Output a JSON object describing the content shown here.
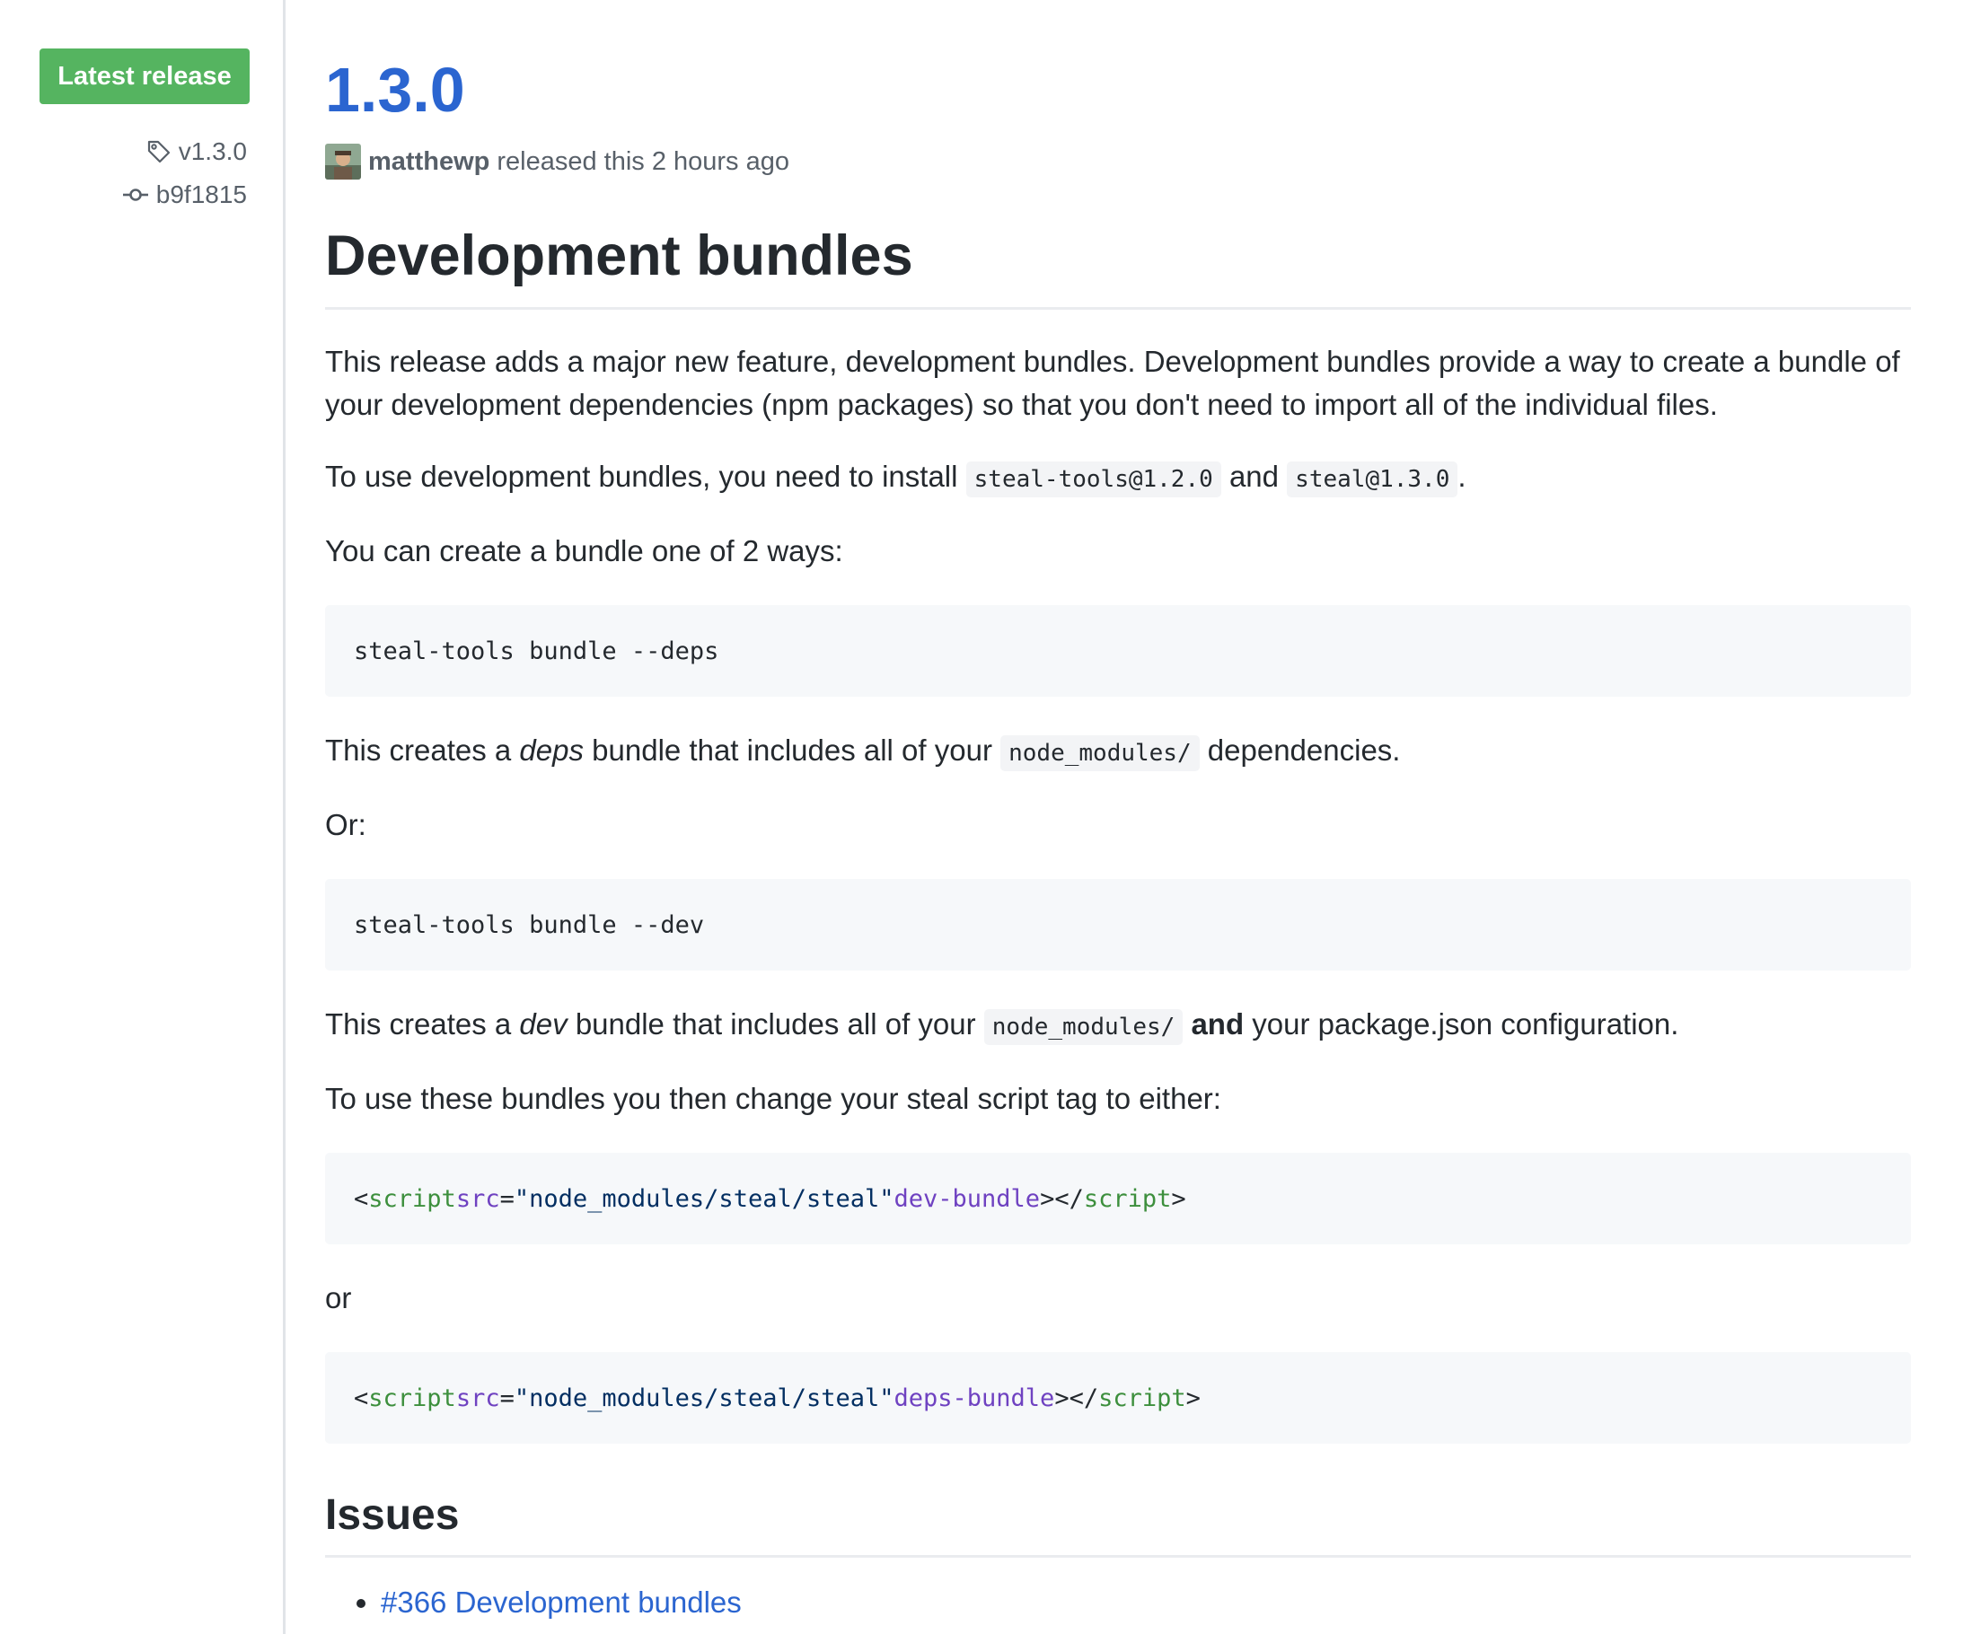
{
  "sidebar": {
    "badge_label": "Latest release",
    "tag": "v1.3.0",
    "commit": "b9f1815"
  },
  "release": {
    "title": "1.3.0",
    "author": "matthewp",
    "released_text": "released this 2 hours ago"
  },
  "body": {
    "heading": "Development bundles",
    "p1": "This release adds a major new feature, development bundles. Development bundles provide a way to create a bundle of your development dependencies (npm packages) so that you don't need to import all of the individual files.",
    "p2_text": "To use development bundles, you need to install",
    "p2_code1": "steal-tools@1.2.0",
    "p2_and": "and",
    "p2_code2": "steal@1.3.0",
    "p2_end": ".",
    "p3": "You can create a bundle one of 2 ways:",
    "code1": "steal-tools bundle --deps",
    "p4_pre": "This creates a",
    "p4_em": "deps",
    "p4_mid": "bundle that includes all of your",
    "p4_code": "node_modules/",
    "p4_end": "dependencies.",
    "p5": "Or:",
    "code2": "steal-tools bundle --dev",
    "p6_pre": "This creates a",
    "p6_em": "dev",
    "p6_mid": "bundle that includes all of your",
    "p6_code": "node_modules/",
    "p6_strong": "and",
    "p6_end": "your package.json configuration.",
    "p7": "To use these bundles you then change your steal script tag to either:",
    "code3": {
      "open": "<",
      "tag": "script",
      "attr": "src",
      "eq": "=",
      "value": "\"node_modules/steal/steal\"",
      "flag": "dev-bundle",
      "mid": "></",
      "tag2": "script",
      "close": ">"
    },
    "p8": "or",
    "code4": {
      "open": "<",
      "tag": "script",
      "attr": "src",
      "eq": "=",
      "value": "\"node_modules/steal/steal\"",
      "flag": "deps-bundle",
      "mid": "></",
      "tag2": "script",
      "close": ">"
    },
    "issues_heading": "Issues",
    "issues": [
      {
        "label": "#366 Development bundles"
      }
    ]
  }
}
